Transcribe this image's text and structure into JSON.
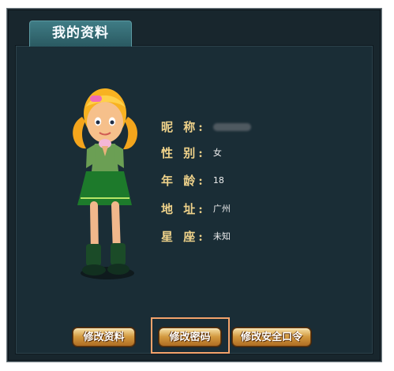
{
  "tab": {
    "title": "我的资料"
  },
  "profile": {
    "nickname": {
      "label": "昵 称:",
      "value": ""
    },
    "gender": {
      "label": "性 别:",
      "value": "女"
    },
    "age": {
      "label": "年 龄:",
      "value": "18"
    },
    "address": {
      "label": "地 址:",
      "value": "广州"
    },
    "constellation": {
      "label": "星 座:",
      "value": "未知"
    }
  },
  "buttons": {
    "edit_profile": "修改资料",
    "change_password": "修改密码",
    "change_security_password": "修改安全口令"
  },
  "colors": {
    "panel_background": "#1a2d36",
    "label": "#efd28a",
    "button_gold": "#d39a3f",
    "highlight": "#f3a26b"
  },
  "icons": {
    "avatar": "girl-character-avatar"
  }
}
